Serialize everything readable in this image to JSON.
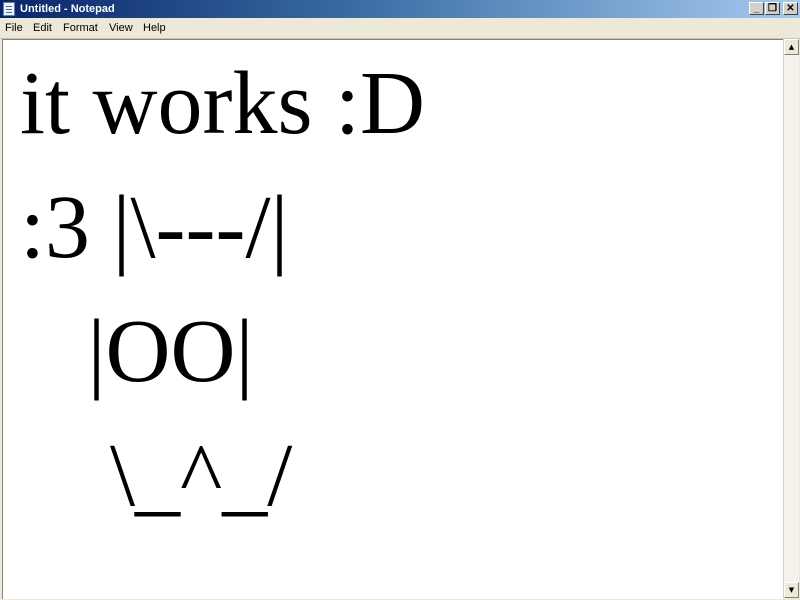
{
  "window": {
    "title": "Untitled - Notepad",
    "controls": {
      "minimize": "_",
      "maximize": "❐",
      "close": "✕"
    }
  },
  "menu": [
    {
      "label": "File"
    },
    {
      "label": "Edit"
    },
    {
      "label": "Format"
    },
    {
      "label": "View"
    },
    {
      "label": "Help"
    }
  ],
  "editor": {
    "lines": [
      "it works :D",
      ":3 |\\---/|",
      "   |OO|",
      "    \\_^_/"
    ]
  },
  "scrollbar": {
    "up": "▲",
    "down": "▼"
  },
  "colors": {
    "title_bar_start": "#0a246a",
    "title_bar_end": "#a6caf0",
    "editor_bg": "#ffffff",
    "text": "#000000"
  }
}
